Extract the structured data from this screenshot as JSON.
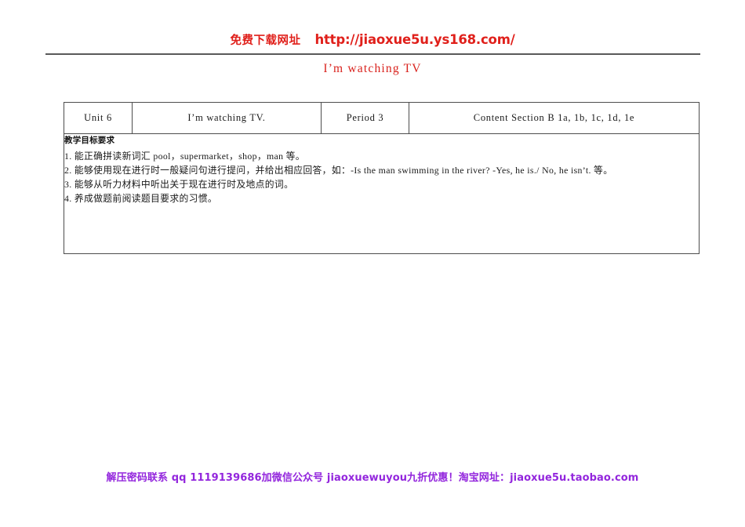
{
  "header": {
    "promo_label": "免费下载网址",
    "promo_url": "http://jiaoxue5u.ys168.com/",
    "accent_color": "#e0201b"
  },
  "document": {
    "title": "I’m watching TV",
    "title_color": "#d9211c"
  },
  "lesson_table": {
    "header_row": {
      "unit": "Unit 6",
      "name": "I’m watching TV.",
      "period": "Period 3",
      "content": "Content  Section B  1a, 1b, 1c, 1d, 1e"
    },
    "objectives": {
      "heading": "教学目标要求",
      "items": [
        "1. 能正确拼读新词汇 pool，supermarket，shop，man 等。",
        "2. 能够使用现在进行时一般疑问句进行提问，并给出相应回答，如：-Is the man swimming in the river? -Yes, he is./ No, he isn’t. 等。",
        "3. 能够从听力材料中听出关于现在进行时及地点的词。",
        "4. 养成做题前阅读题目要求的习惯。"
      ]
    }
  },
  "footer": {
    "part1": "解压密码联系 qq 1119139686",
    "part2": "加微信公众号 jiaoxuewuyou",
    "part3": "九折优惠！淘宝网址：jiaoxue5u.taobao.com",
    "accent_color": "#9326dd"
  }
}
